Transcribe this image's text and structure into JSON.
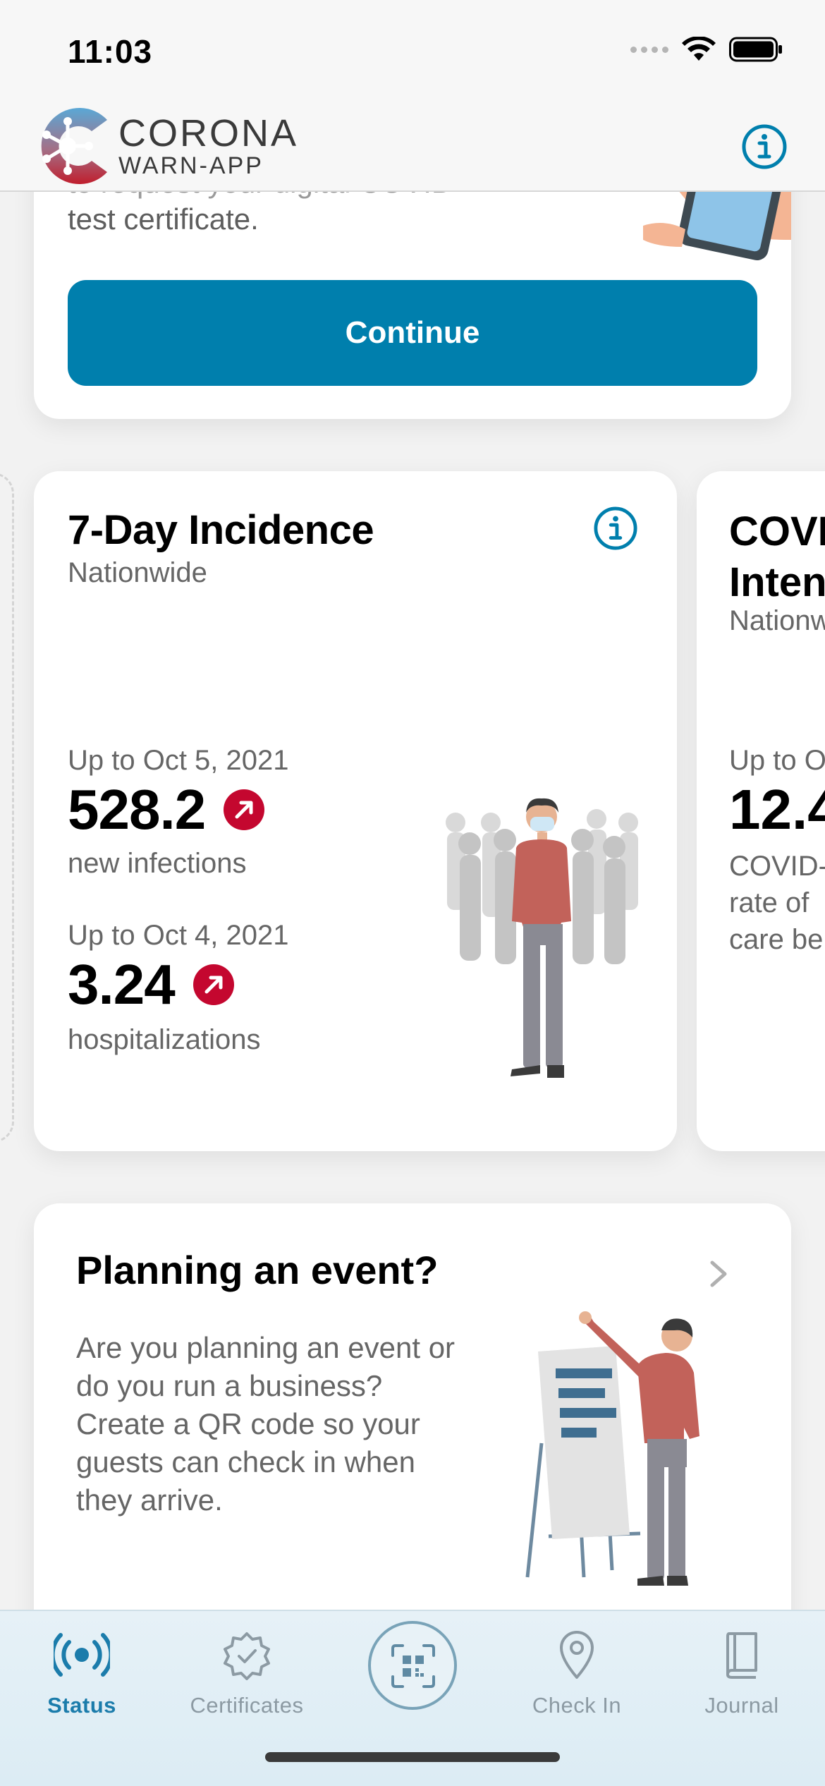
{
  "status_bar": {
    "time": "11:03"
  },
  "header": {
    "logo_title": "CORONA",
    "logo_subtitle": "WARN-APP",
    "info_icon": "info-icon"
  },
  "test_card": {
    "text_line1": "to request your digital COVID",
    "text_line2": "test certificate.",
    "button_label": "Continue"
  },
  "incidence_card": {
    "title": "7-Day Incidence",
    "subtitle": "Nationwide",
    "date_1": "Up to Oct 5, 2021",
    "value_1": "528.2",
    "trend_1": "up",
    "desc_1": "new infections",
    "date_2": "Up to Oct 4, 2021",
    "value_2": "3.24",
    "trend_2": "up",
    "desc_2": "hospitalizations"
  },
  "next_card": {
    "title": "COVI\nInten",
    "subtitle": "Nationw",
    "date": "Up to O",
    "value": "12.4",
    "desc": "COVID-\nrate of\ncare be"
  },
  "event_card": {
    "title": "Planning an event?",
    "text": "Are you planning an event or do you run a business? Create a QR code so your guests can check in when they arrive."
  },
  "tabs": [
    {
      "label": "Status",
      "icon": "status-broadcast-icon",
      "active": true
    },
    {
      "label": "Certificates",
      "icon": "certificate-badge-icon",
      "active": false
    },
    {
      "label": "",
      "icon": "qr-scan-icon",
      "active": false
    },
    {
      "label": "Check In",
      "icon": "location-pin-icon",
      "active": false
    },
    {
      "label": "Journal",
      "icon": "journal-book-icon",
      "active": false
    }
  ],
  "colors": {
    "accent": "#007fad",
    "trend_red": "#c4072f",
    "tab_active": "#1b7cab",
    "tab_inactive": "#8c9aa3"
  }
}
